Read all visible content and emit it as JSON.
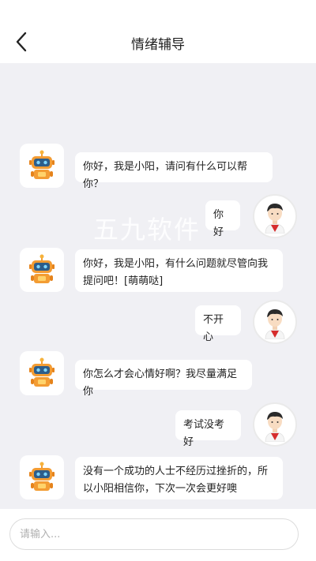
{
  "header": {
    "title": "情绪辅导"
  },
  "watermark": "五九软件",
  "messages": [
    {
      "from": "bot",
      "text": "你好，我是小阳，请问有什么可以帮你？"
    },
    {
      "from": "user",
      "text": "你好"
    },
    {
      "from": "bot",
      "text": "你好，我是小阳，有什么问题就尽管向我提问吧！[萌萌哒]"
    },
    {
      "from": "user",
      "text": "不开心"
    },
    {
      "from": "bot",
      "text": "你怎么才会心情好啊？我尽量满足你"
    },
    {
      "from": "user",
      "text": "考试没考好"
    },
    {
      "from": "bot",
      "text": "没有一个成功的人士不经历过挫折的，所以小阳相信你，下次一次会更好噢"
    }
  ],
  "input": {
    "placeholder": "请输入..."
  },
  "icons": {
    "back": "back-arrow-icon",
    "bot": "robot-avatar-icon",
    "user": "user-avatar-icon"
  }
}
